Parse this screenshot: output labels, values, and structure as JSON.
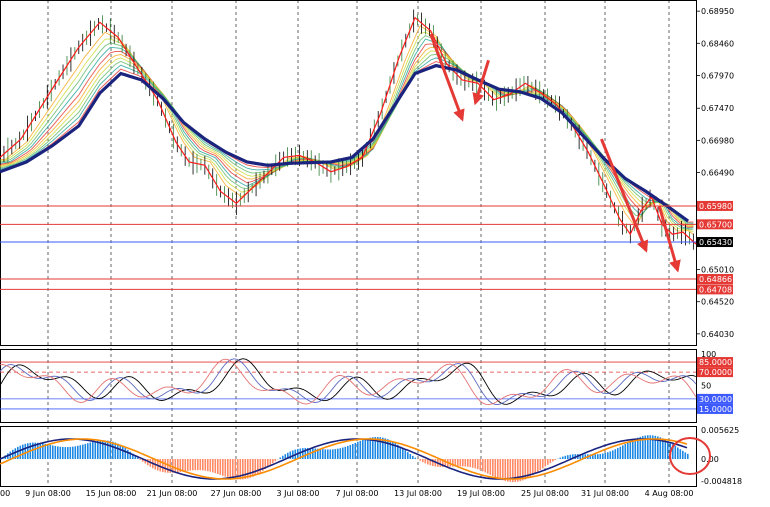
{
  "chart_data": [
    {
      "type": "line",
      "panel": "price",
      "y_ticks": [
        0.6895,
        0.6846,
        0.6797,
        0.6747,
        0.6698,
        0.6649,
        0.6601,
        0.655,
        0.6501,
        0.6452,
        0.6403
      ],
      "y_tick_labels": [
        "0.68950",
        "0.68460",
        "0.67970",
        "0.67470",
        "0.66980",
        "0.66490",
        "",
        "",
        "0.65010",
        "0.64520",
        "0.64030"
      ],
      "ylim": [
        0.6386,
        0.6912
      ],
      "x_labels": [
        "9 Jun 08:00",
        "15 Jun 08:00",
        "21 Jun 08:00",
        "27 Jun 08:00",
        "3 Jul 08:00",
        "7 Jul 08:00",
        "13 Jul 08:00",
        "19 Jul 08:00",
        "25 Jul 08:00",
        "31 Jul 08:00",
        "4 Aug 08:00"
      ],
      "x_label_left_fragment": "00",
      "price_path": [
        [
          0,
          0.6672
        ],
        [
          8,
          0.67
        ],
        [
          15,
          0.6745
        ],
        [
          22,
          0.679
        ],
        [
          30,
          0.684
        ],
        [
          38,
          0.6878
        ],
        [
          45,
          0.6855
        ],
        [
          52,
          0.681
        ],
        [
          60,
          0.676
        ],
        [
          67,
          0.6695
        ],
        [
          72,
          0.6665
        ],
        [
          78,
          0.666
        ],
        [
          84,
          0.662
        ],
        [
          90,
          0.6602
        ],
        [
          96,
          0.6625
        ],
        [
          102,
          0.6648
        ],
        [
          108,
          0.6672
        ],
        [
          114,
          0.6675
        ],
        [
          120,
          0.6665
        ],
        [
          126,
          0.665
        ],
        [
          132,
          0.6658
        ],
        [
          138,
          0.6672
        ],
        [
          145,
          0.674
        ],
        [
          152,
          0.6825
        ],
        [
          158,
          0.6885
        ],
        [
          164,
          0.6865
        ],
        [
          170,
          0.6815
        ],
        [
          176,
          0.679
        ],
        [
          182,
          0.6785
        ],
        [
          188,
          0.676
        ],
        [
          194,
          0.6768
        ],
        [
          200,
          0.6785
        ],
        [
          206,
          0.677
        ],
        [
          212,
          0.6752
        ],
        [
          218,
          0.672
        ],
        [
          224,
          0.668
        ],
        [
          230,
          0.663
        ],
        [
          236,
          0.6578
        ],
        [
          240,
          0.6555
        ],
        [
          244,
          0.659
        ],
        [
          248,
          0.6612
        ],
        [
          252,
          0.657
        ],
        [
          256,
          0.6555
        ],
        [
          260,
          0.6558
        ],
        [
          265,
          0.654
        ]
      ],
      "price_x_max": 265,
      "moving_average_path": [
        [
          0,
          0.665
        ],
        [
          10,
          0.6665
        ],
        [
          20,
          0.669
        ],
        [
          30,
          0.672
        ],
        [
          38,
          0.677
        ],
        [
          46,
          0.68
        ],
        [
          54,
          0.679
        ],
        [
          62,
          0.6762
        ],
        [
          70,
          0.6725
        ],
        [
          78,
          0.67
        ],
        [
          86,
          0.668
        ],
        [
          94,
          0.6665
        ],
        [
          102,
          0.666
        ],
        [
          110,
          0.6663
        ],
        [
          118,
          0.6664
        ],
        [
          126,
          0.6665
        ],
        [
          134,
          0.6672
        ],
        [
          142,
          0.67
        ],
        [
          150,
          0.675
        ],
        [
          158,
          0.68
        ],
        [
          166,
          0.6812
        ],
        [
          174,
          0.6805
        ],
        [
          182,
          0.679
        ],
        [
          190,
          0.6776
        ],
        [
          198,
          0.6772
        ],
        [
          206,
          0.6762
        ],
        [
          214,
          0.674
        ],
        [
          222,
          0.6705
        ],
        [
          230,
          0.667
        ],
        [
          238,
          0.664
        ],
        [
          246,
          0.662
        ],
        [
          254,
          0.6598
        ],
        [
          262,
          0.6575
        ]
      ],
      "current_price": "0.65430",
      "horizontal_levels": [
        {
          "value": 0.6598,
          "label": "0.65980",
          "color": "#e53935"
        },
        {
          "value": 0.657,
          "label": "0.65700",
          "color": "#e53935"
        },
        {
          "value": 0.6543,
          "label": "0.65430",
          "color": "#3d5afe"
        },
        {
          "value": 0.64866,
          "label": "0.64866",
          "color": "#e53935"
        },
        {
          "value": 0.64708,
          "label": "0.64708",
          "color": "#e53935"
        }
      ],
      "arrow_annotations": [
        {
          "from": [
            164,
            0.686
          ],
          "to": [
            176,
            0.673
          ]
        },
        {
          "from": [
            186,
            0.682
          ],
          "to": [
            181,
            0.6755
          ]
        },
        {
          "from": [
            229,
            0.67
          ],
          "to": [
            246,
            0.653
          ]
        },
        {
          "from": [
            251,
            0.6598
          ],
          "to": [
            258,
            0.65
          ]
        }
      ],
      "colors": {
        "price": "#ff1a1a",
        "moving_average": "#1a237e",
        "ribbon": [
          "#f9a825",
          "#cddc39",
          "#66bb6a",
          "#26a69a",
          "#e53935"
        ]
      }
    },
    {
      "type": "line",
      "panel": "oscillator",
      "ylim": [
        0,
        100
      ],
      "levels": [
        {
          "value": 85.0,
          "label": "85.0000",
          "color": "#e53935"
        },
        {
          "value": 70.0,
          "label": "70.0000",
          "color": "#e53935"
        },
        {
          "value": 30.0,
          "label": "30.0000",
          "color": "#3d5afe"
        },
        {
          "value": 15.0,
          "label": "15.0000",
          "color": "#3d5afe"
        }
      ],
      "tick_labels": [
        "100",
        "50"
      ]
    },
    {
      "type": "bar",
      "panel": "histogram",
      "tick_labels": [
        "0.005625",
        "0.00",
        "-0.004818"
      ],
      "highlight": "circle",
      "colors": {
        "positive": "#1e88e5",
        "negative": "#ff8a65",
        "fast": "#1a237e",
        "slow": "#fb8c00"
      }
    }
  ]
}
